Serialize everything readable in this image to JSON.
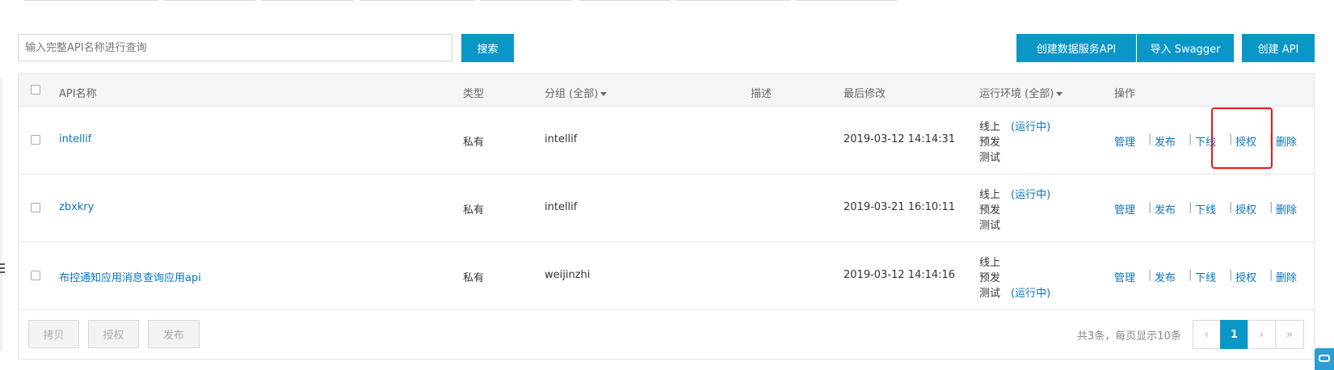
{
  "search": {
    "placeholder": "输入完整API名称进行查询",
    "button_label": "搜索"
  },
  "actions": {
    "create_data_service_api": "创建数据服务API",
    "import_swagger": "导入 Swagger",
    "create_api": "创建 API"
  },
  "table": {
    "columns": {
      "name": "API名称",
      "type": "类型",
      "group": "分组 (全部)",
      "description": "描述",
      "last_modified": "最后修改",
      "env": "运行环境 (全部)",
      "operations": "操作"
    },
    "rows": [
      {
        "name": "intellif",
        "type": "私有",
        "group": "intellif",
        "description": "",
        "last_modified": "2019-03-12 14:14:31",
        "env_online": "线上",
        "env_pre": "预发",
        "env_test": "测试",
        "env_status": "(运行中)"
      },
      {
        "name": "zbxkry",
        "type": "私有",
        "group": "intellif",
        "description": "",
        "last_modified": "2019-03-21 16:10:11",
        "env_online": "线上",
        "env_pre": "预发",
        "env_test": "测试",
        "env_status": "(运行中)"
      },
      {
        "name": "布控通知应用消息查询应用api",
        "type": "私有",
        "group": "weijinzhi",
        "description": "",
        "last_modified": "2019-03-12 14:14:16",
        "env_online": "线上",
        "env_pre": "预发",
        "env_test": "测试",
        "env_status": "(运行中)"
      }
    ],
    "ops": {
      "manage": "管理",
      "publish": "发布",
      "offline": "下线",
      "authorize": "授权",
      "delete": "删除",
      "separator": "|"
    }
  },
  "footer": {
    "copy": "拷贝",
    "authorize": "授权",
    "publish": "发布",
    "page_info": "共3条，每页显示10条",
    "prev": "‹",
    "current_page": "1",
    "next": "›",
    "last": "»"
  },
  "colors": {
    "primary": "#0b97c6",
    "link": "#0a73bd",
    "highlight": "#f01414"
  }
}
